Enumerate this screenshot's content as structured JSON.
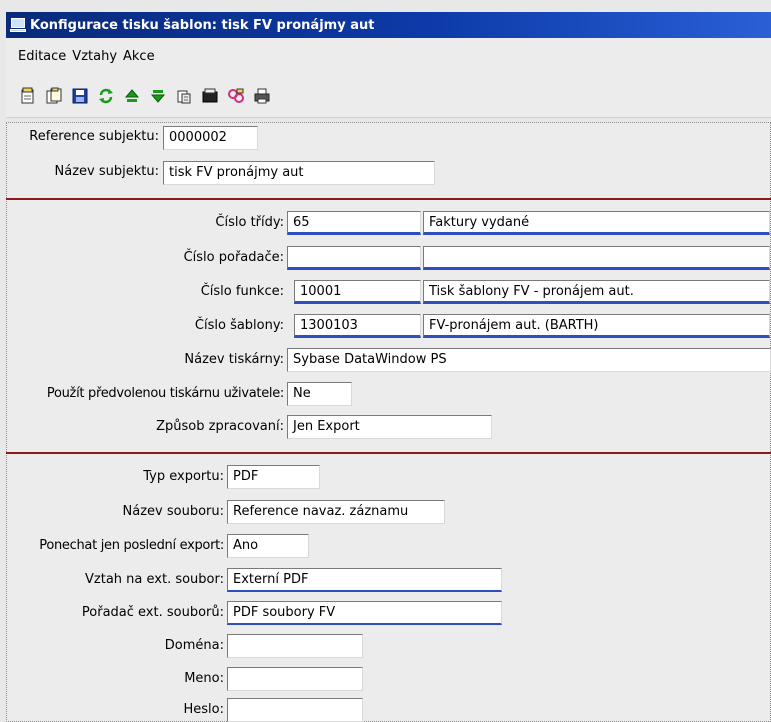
{
  "window": {
    "title": "Konfigurace tisku šablon: tisk FV pronájmy aut"
  },
  "menu": [
    "Editace",
    "Vztahy",
    "Akce"
  ],
  "toolbar": [
    "new-doc-icon",
    "copy-doc-icon",
    "save-icon",
    "refresh-icon",
    "move-up-icon",
    "move-down-icon",
    "paste-icon",
    "delete-icon",
    "relations-icon",
    "print-icon"
  ],
  "colors": {
    "titlebar": "#0c3aa8",
    "separator": "#8b1a1a",
    "field_underline": "#2f4fbf"
  },
  "subject": {
    "ref_label": "Reference subjektu:",
    "ref_value": "0000002",
    "name_label": "Název subjektu:",
    "name_value": "tisk FV pronájmy aut"
  },
  "print": {
    "class_label": "Číslo třídy:",
    "class_value": "65",
    "class_desc": "Faktury vydané",
    "binder_label": "Číslo pořadače:",
    "binder_value": "",
    "binder_desc": "",
    "func_label": "Číslo funkce:",
    "func_value": "10001",
    "func_desc": "Tisk šablony FV - pronájem aut.",
    "tpl_label": "Číslo šablony:",
    "tpl_value": "1300103",
    "tpl_desc": "FV-pronájem aut. (BARTH)",
    "printer_label": "Název tiskárny:",
    "printer_value": "Sybase DataWindow PS",
    "default_label": "Použít předvolenou tiskárnu uživatele:",
    "default_value": "Ne",
    "proc_label": "Způsob zpracovaní:",
    "proc_value": "Jen Export"
  },
  "export": {
    "type_label": "Typ exportu:",
    "type_value": "PDF",
    "file_label": "Název souboru:",
    "file_value": "Reference navaz. záznamu",
    "last_label": "Ponechat jen poslední export:",
    "last_value": "Ano",
    "rel_label": "Vztah na ext. soubor:",
    "rel_value": "Externí PDF",
    "folder_label": "Pořadač ext. souborů:",
    "folder_value": "PDF soubory FV",
    "domain_label": "Doména:",
    "domain_value": "",
    "user_label": "Meno:",
    "user_value": "",
    "pass_label": "Heslo:",
    "pass_value": ""
  }
}
